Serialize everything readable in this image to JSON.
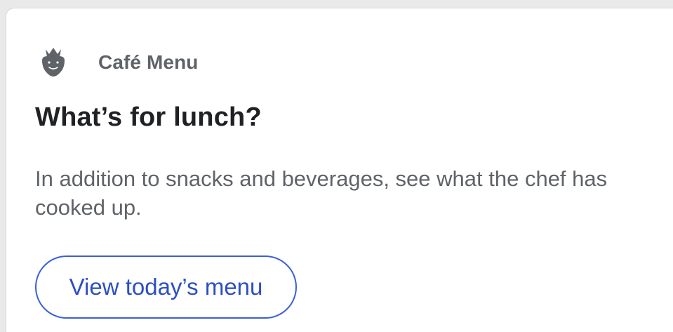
{
  "app": {
    "name": "Café Menu",
    "icon": "strawberry-icon"
  },
  "card": {
    "title": "What’s for lunch?",
    "body": "In addition to snacks and beverages, see what the chef has cooked up.",
    "button_label": "View today’s menu"
  },
  "colors": {
    "accent": "#3b5fd9",
    "icon": "#5f6368",
    "title": "#202124",
    "body": "#5f6368"
  }
}
